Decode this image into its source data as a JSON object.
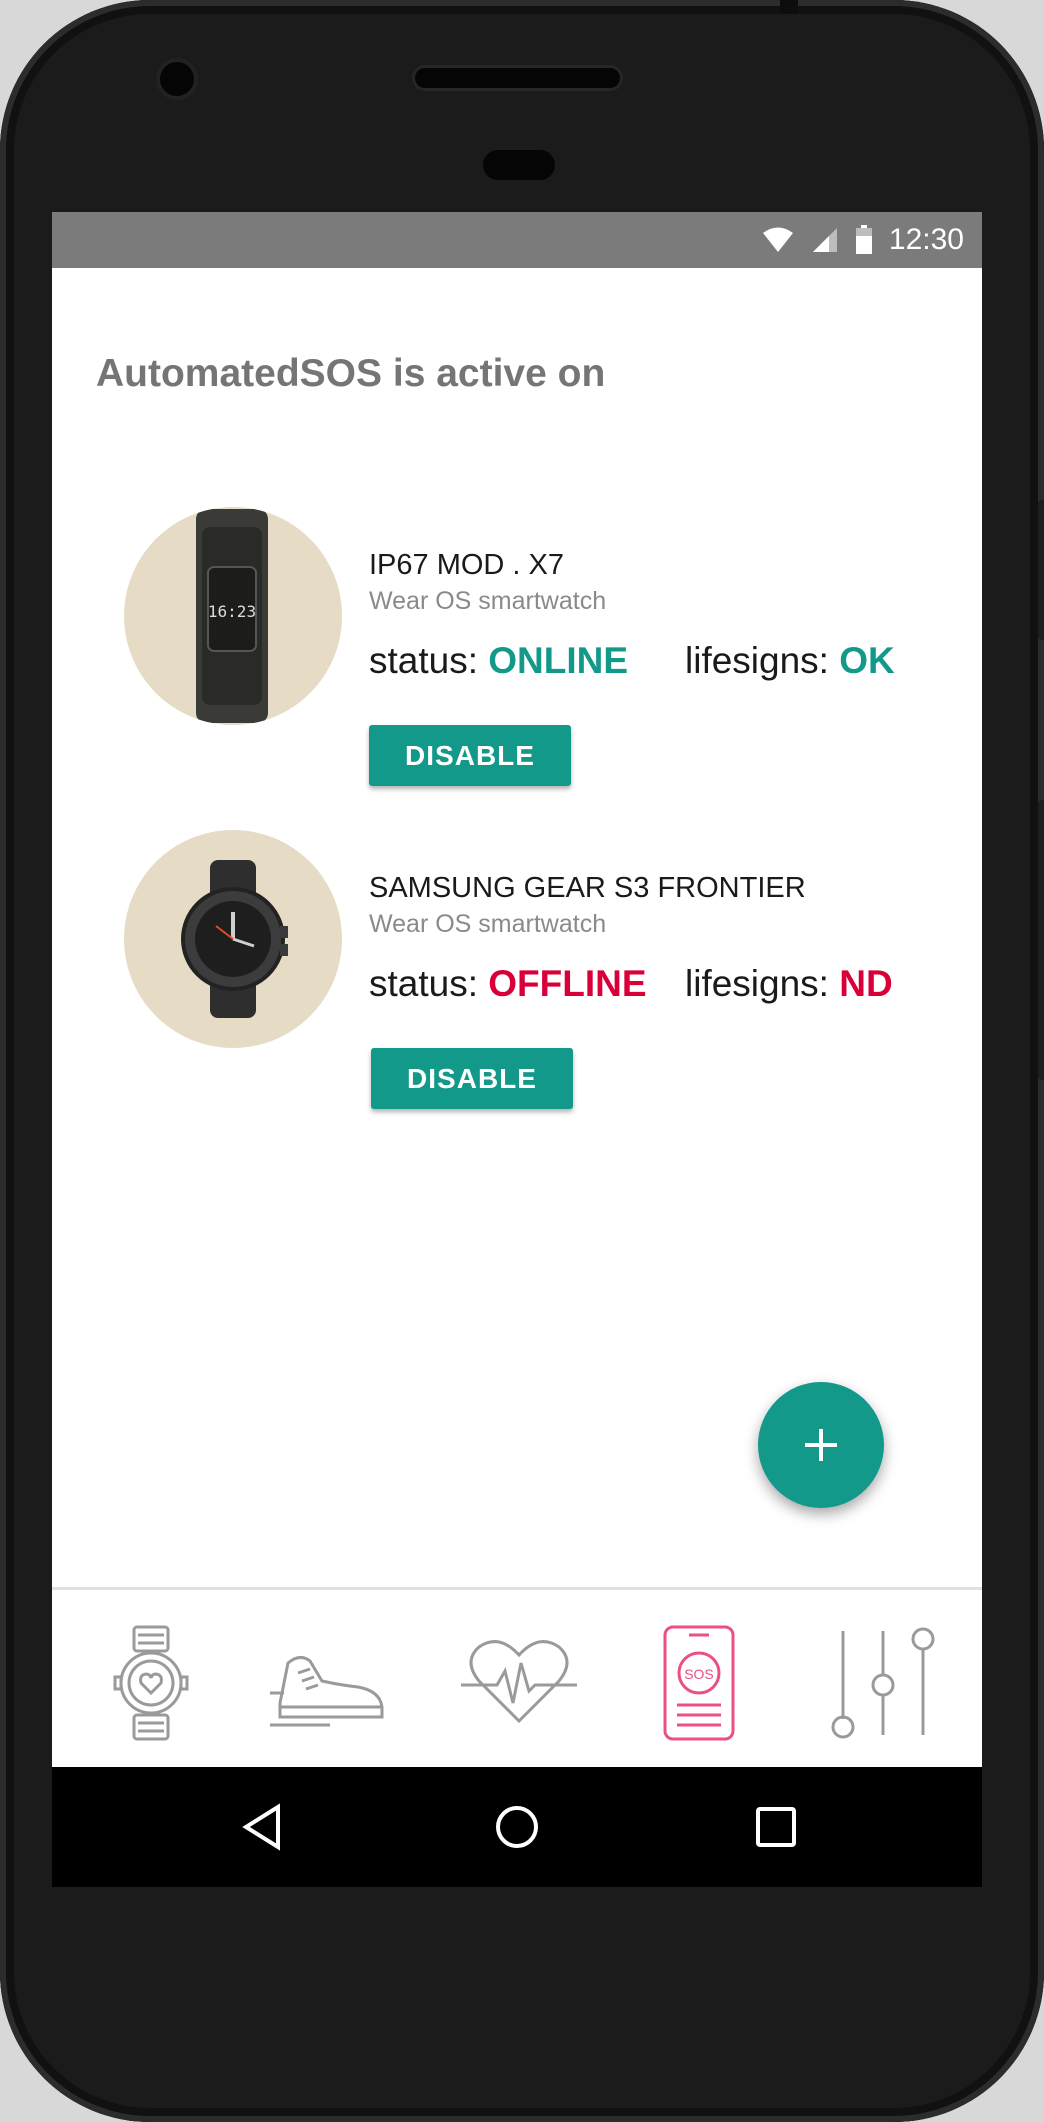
{
  "statusbar": {
    "time": "12:30",
    "icons": [
      "wifi-icon",
      "signal-icon",
      "battery-icon"
    ]
  },
  "headline": "AutomatedSOS is active on",
  "devices": [
    {
      "name": "IP67 MOD . X7",
      "type": "Wear OS smartwatch",
      "status_label": "status:",
      "status_value": "ONLINE",
      "lifesigns_label": "lifesigns:",
      "lifesigns_value": "OK",
      "button_label": "DISABLE",
      "watch_display": "16:23"
    },
    {
      "name": "SAMSUNG GEAR S3 FRONTIER",
      "type": "Wear OS smartwatch",
      "status_label": "status:",
      "status_value": "OFFLINE",
      "lifesigns_label": "lifesigns:",
      "lifesigns_value": "ND",
      "button_label": "DISABLE"
    }
  ],
  "fab": {
    "icon": "plus-icon"
  },
  "bottom_nav": [
    {
      "icon": "smartwatch-heart-icon",
      "active": false
    },
    {
      "icon": "sneaker-icon",
      "active": false
    },
    {
      "icon": "heartbeat-icon",
      "active": false
    },
    {
      "icon": "phone-sos-icon",
      "label": "SOS",
      "active": true
    },
    {
      "icon": "sliders-icon",
      "active": false
    }
  ],
  "system_nav": [
    "back-icon",
    "home-icon",
    "recents-icon"
  ],
  "colors": {
    "accent": "#13998a",
    "alert": "#d9003a",
    "active_nav": "#ec4f86",
    "nav_icon": "#9a9a9a"
  }
}
